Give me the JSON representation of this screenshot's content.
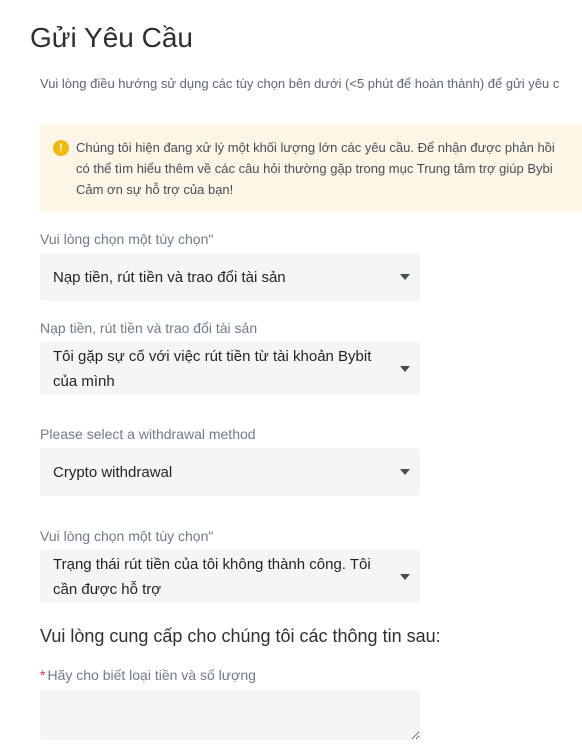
{
  "page": {
    "title": "Gửi Yêu Cầu",
    "subtitle": "Vui lòng điều hướng sử dụng các tùy chọn bên dưới (<5 phút để hoàn thành) để gửi yêu c"
  },
  "notice": {
    "icon": "info-icon",
    "color": "#f0b90b",
    "line1": "Chúng tôi hiện đang xử lý một khối lượng lớn các yêu cầu. Để nhận được phản hồi",
    "line2": "có thể tìm hiểu thêm về các câu hỏi thường gặp trong mục Trung tâm trợ giúp Bybi",
    "line3": "Cảm ơn sự hỗ trợ của bạn!"
  },
  "fields": {
    "f1": {
      "label": "Vui lòng chọn một tùy chọn\"",
      "value": "Nạp tiền, rút tiền và trao đổi tài sản"
    },
    "f2": {
      "label": "Nạp tiền, rút tiền và trao đổi tài sản",
      "value": "Tôi gặp sự cố với việc rút tiền từ tài khoản Bybit của mình"
    },
    "f3": {
      "label": "Please select a withdrawal method",
      "value": "Crypto withdrawal"
    },
    "f4": {
      "label": "Vui lòng chọn một tùy chọn\"",
      "value": "Trạng thái rút tiền của tôi không thành công. Tôi cần được hỗ trợ"
    }
  },
  "info_section": {
    "title": "Vui lòng cung cấp cho chúng tôi các thông tin sau:",
    "required_mark": "*",
    "currency_label": "Hãy cho biết loại tiền và số lượng",
    "currency_value": ""
  }
}
